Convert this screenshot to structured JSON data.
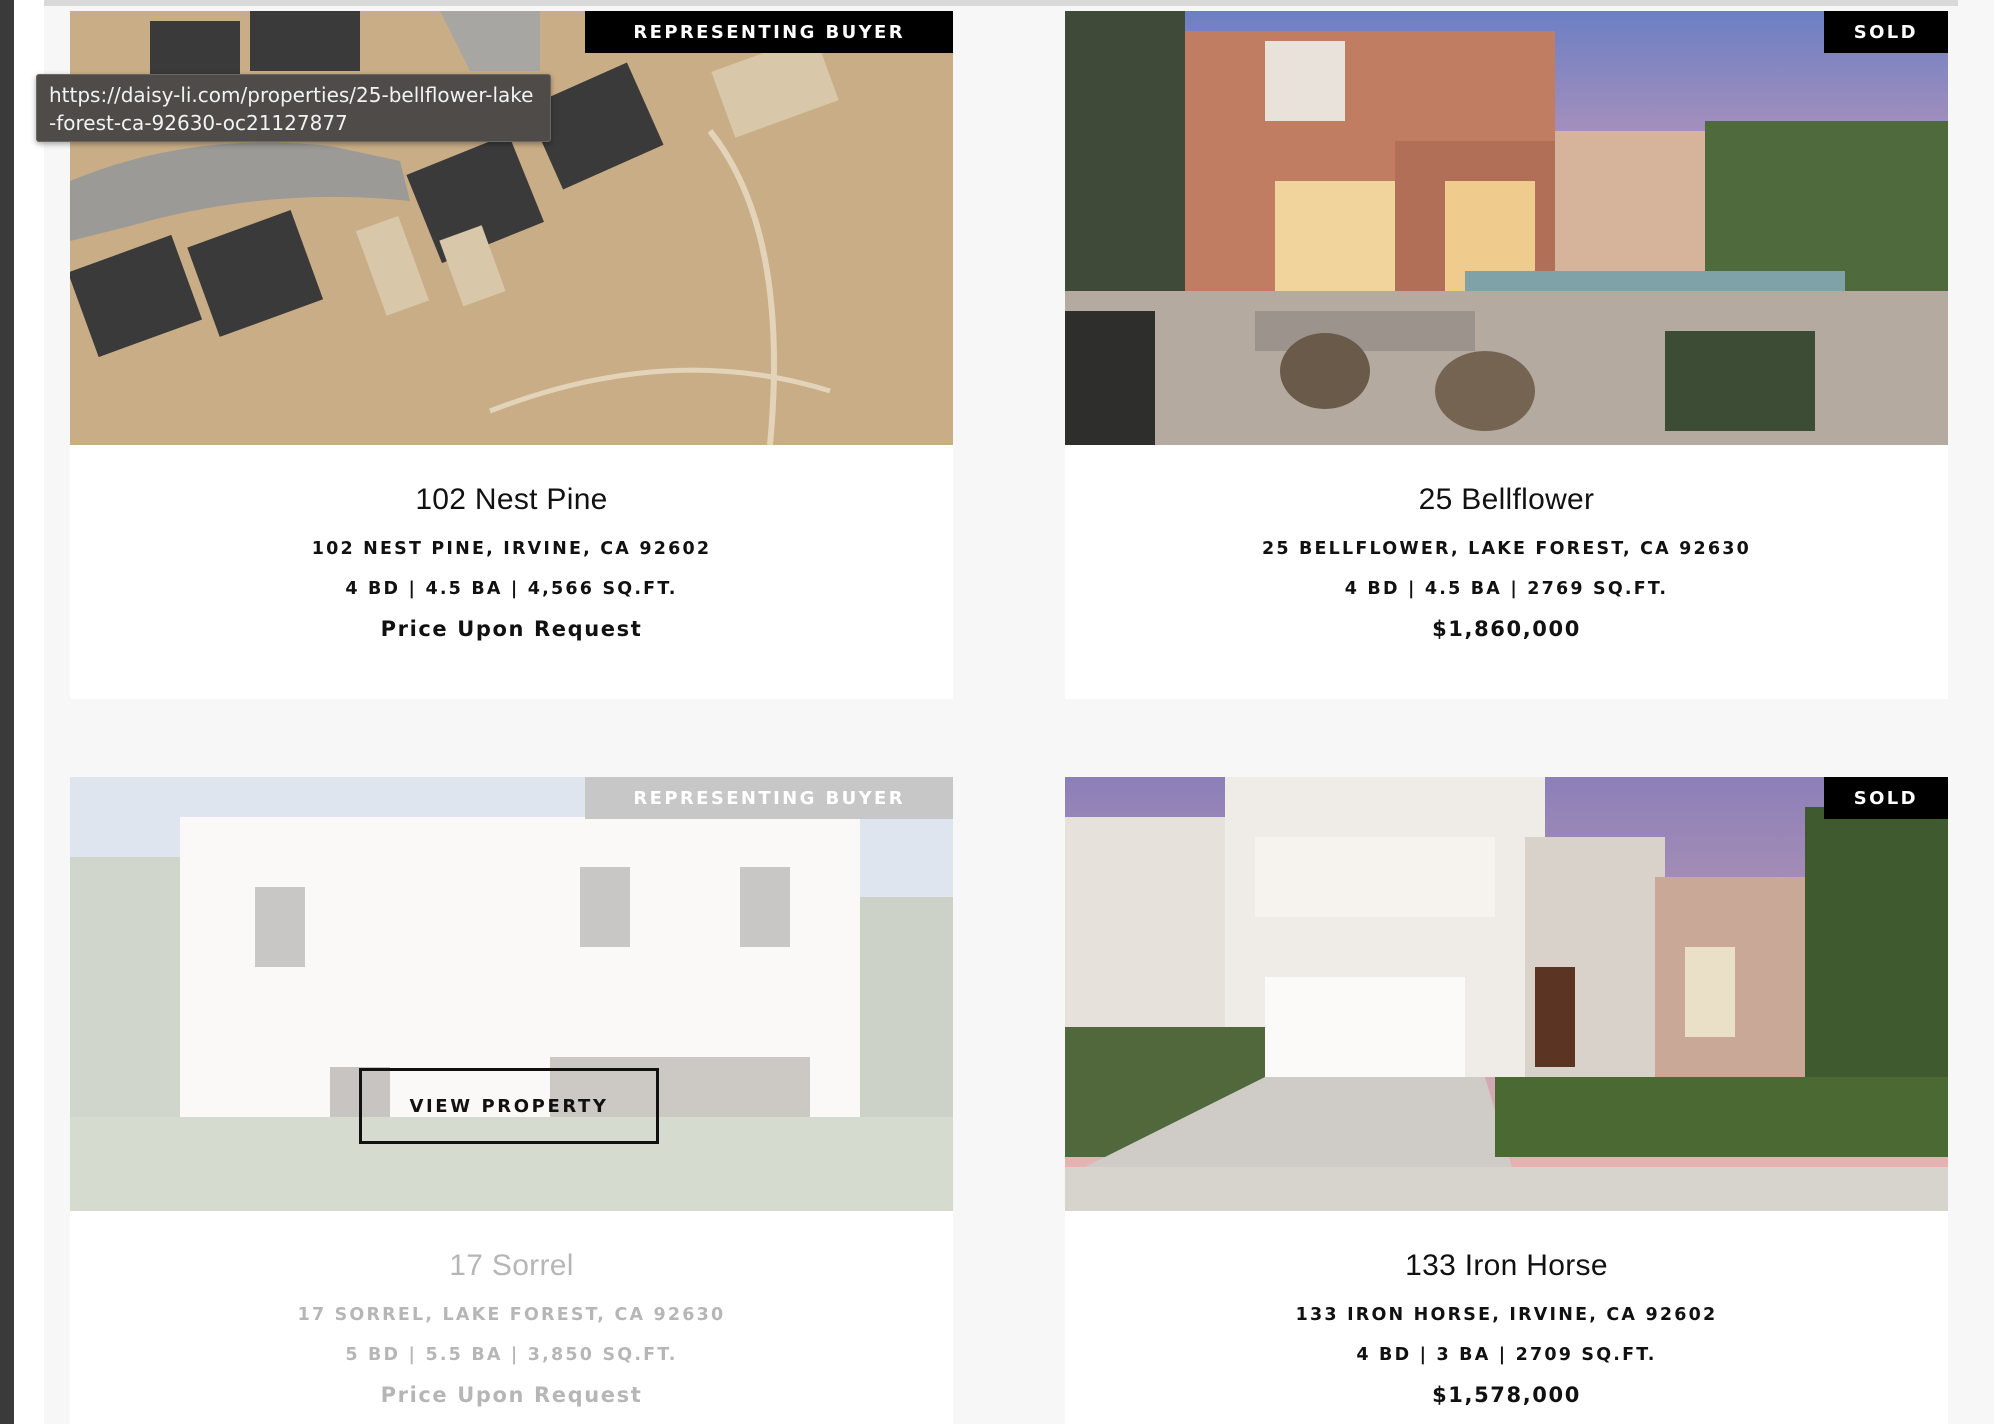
{
  "tooltip": {
    "text": "https://daisy-li.com/properties/25-bellflower-lake-forest-ca-92630-oc21127877"
  },
  "listings": [
    {
      "title": "102 Nest Pine",
      "address": "102 NEST PINE, IRVINE, CA 92602",
      "specs": "4 BD | 4.5 BA | 4,566 SQ.FT.",
      "price": "Price Upon Request",
      "badge": "REPRESENTING BUYER",
      "image": "aerial view of houses under construction"
    },
    {
      "title": "25 Bellflower",
      "address": "25 BELLFLOWER, LAKE FOREST, CA 92630",
      "specs": "4 BD | 4.5 BA | 2769 SQ.FT.",
      "price": "$1,860,000",
      "badge": "SOLD",
      "image": "backyard with pool at dusk"
    },
    {
      "title": "17 Sorrel",
      "address": "17 SORREL, LAKE FOREST, CA 92630",
      "specs": "5 BD | 5.5 BA | 3,850 SQ.FT.",
      "price": "Price Upon Request",
      "badge": "REPRESENTING BUYER",
      "image": "white two-story house front",
      "hover_button": "VIEW PROPERTY"
    },
    {
      "title": "133 Iron Horse",
      "address": "133 IRON HORSE, IRVINE, CA 92602",
      "specs": "4 BD | 3 BA | 2709 SQ.FT.",
      "price": "$1,578,000",
      "badge": "SOLD",
      "image": "house with garage and driveway"
    }
  ],
  "colors": {
    "page_background": "#f7f7f7",
    "card_background": "#ffffff",
    "badge_background": "#000000",
    "text": "#111111"
  }
}
